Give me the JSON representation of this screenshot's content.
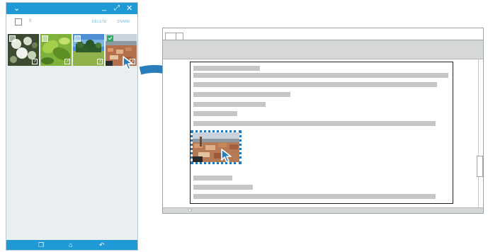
{
  "phone": {
    "topbar_icons": [
      "chevron-down-icon",
      "minimize-icon",
      "expand-icon",
      "close-icon"
    ],
    "header": {
      "selected_count": "0",
      "actions": [
        "DELETE",
        "SHARE"
      ]
    },
    "thumbnails": [
      {
        "subject": "white flowers",
        "selected": false
      },
      {
        "subject": "green leaves",
        "selected": false
      },
      {
        "subject": "field with trees",
        "selected": false
      },
      {
        "subject": "city rooftops",
        "selected": true
      }
    ],
    "nav_icons": [
      "recent-apps-icon",
      "home-icon",
      "back-icon"
    ],
    "colors": {
      "accent": "#1f9ad6",
      "checked": "#33a864"
    }
  },
  "document_window": {
    "drop_target_color": "#1f78b8",
    "dropped_image": "city rooftops"
  }
}
